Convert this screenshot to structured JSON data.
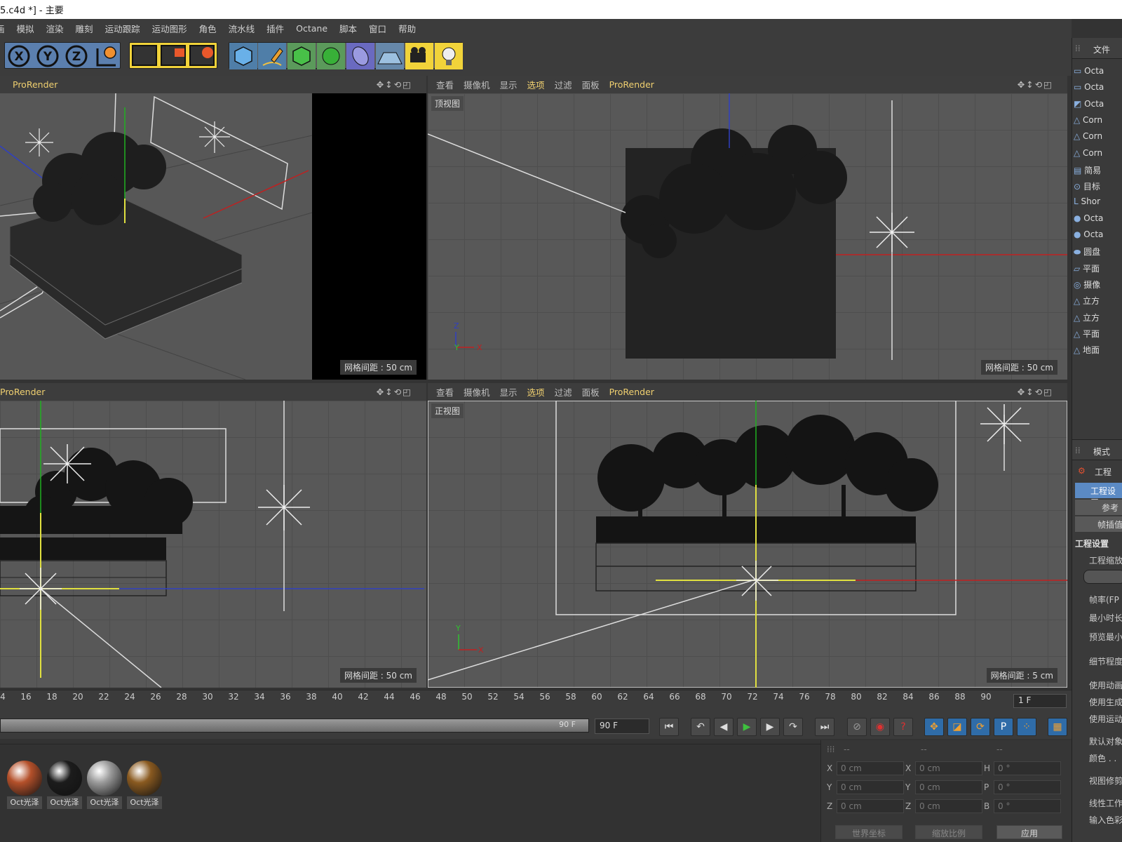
{
  "title_bar": {
    "text": "5.c4d *] - 主要"
  },
  "menu": [
    "画",
    "模拟",
    "渲染",
    "雕刻",
    "运动跟踪",
    "运动图形",
    "角色",
    "流水线",
    "插件",
    "Octane",
    "脚本",
    "窗口",
    "帮助"
  ],
  "toolbar": {
    "axis_buttons": [
      "X",
      "Y",
      "Z"
    ],
    "icons": [
      "world-coord-icon",
      "render-view-icon",
      "render-picture-viewer-icon",
      "render-settings-icon",
      "cube-icon",
      "pen-icon",
      "subdivision-icon",
      "cloner-icon",
      "deformer-icon",
      "floor-icon",
      "camera-icon",
      "light-icon"
    ]
  },
  "viewports": {
    "perspective": {
      "menu": [
        "ProRender"
      ],
      "grid_label": "网格间距 : 50 cm"
    },
    "top": {
      "menu": [
        "查看",
        "摄像机",
        "显示",
        "选项",
        "过滤",
        "面板",
        "ProRender"
      ],
      "view_name": "顶视图",
      "grid_label": "网格间距 : 50 cm",
      "axes": [
        "Z",
        "Y",
        "X"
      ]
    },
    "right": {
      "menu": [
        "ProRender"
      ],
      "grid_label": "网格间距 : 50 cm"
    },
    "front": {
      "menu": [
        "查看",
        "摄像机",
        "显示",
        "选项",
        "过滤",
        "面板",
        "ProRender"
      ],
      "view_name": "正视图",
      "grid_label": "网格间距 : 5 cm",
      "axes": [
        "Y",
        "X"
      ]
    }
  },
  "timeline": {
    "ticks": [
      "4",
      "16",
      "18",
      "20",
      "22",
      "24",
      "26",
      "28",
      "30",
      "32",
      "34",
      "36",
      "38",
      "40",
      "42",
      "44",
      "46",
      "48",
      "50",
      "52",
      "54",
      "56",
      "58",
      "60",
      "62",
      "64",
      "66",
      "68",
      "70",
      "72",
      "74",
      "76",
      "78",
      "80",
      "82",
      "84",
      "86",
      "88",
      "90"
    ],
    "current_frame": "1 F",
    "end_frame_slider": "90 F",
    "end_frame_field": "90 F"
  },
  "materials": [
    {
      "label": "Oct光泽",
      "color": "#b4502a"
    },
    {
      "label": "Oct光泽",
      "color": "#1c1c1c"
    },
    {
      "label": "Oct光泽",
      "color": "#9a9a9a"
    },
    {
      "label": "Oct光泽",
      "color": "#8a5a20"
    }
  ],
  "coordinates": {
    "header": [
      "--",
      "--",
      "--"
    ],
    "rows": [
      {
        "a": "X",
        "av": "0 cm",
        "b": "X",
        "bv": "0 cm",
        "c": "H",
        "cv": "0 °"
      },
      {
        "a": "Y",
        "av": "0 cm",
        "b": "Y",
        "bv": "0 cm",
        "c": "P",
        "cv": "0 °"
      },
      {
        "a": "Z",
        "av": "0 cm",
        "b": "Z",
        "bv": "0 cm",
        "c": "B",
        "cv": "0 °"
      }
    ],
    "dropdown_world": "世界坐标",
    "dropdown_scale": "缩放比例",
    "apply": "应用"
  },
  "object_manager": {
    "header": "文件",
    "items": [
      "Octa",
      "Octa",
      "Octa",
      "Corn",
      "Corn",
      "Corn",
      "简易",
      "目标",
      "Shor",
      "Octa",
      "Octa",
      "圆盘",
      "平面",
      "摄像",
      "立方",
      "立方",
      "平面",
      "地面"
    ]
  },
  "attribute_manager": {
    "header": "模式",
    "project": "工程",
    "tabs": [
      "工程设置",
      "参考",
      "帧插值"
    ],
    "section": "工程设置",
    "fields": [
      "工程缩放",
      "帧率(FP",
      "最小时长",
      "预览最小",
      "细节程度",
      "使用动画",
      "使用生成",
      "使用运动",
      "默认对象",
      "颜色 . ."
    ],
    "more": [
      "视图修剪",
      "线性工作",
      "输入色彩"
    ]
  }
}
